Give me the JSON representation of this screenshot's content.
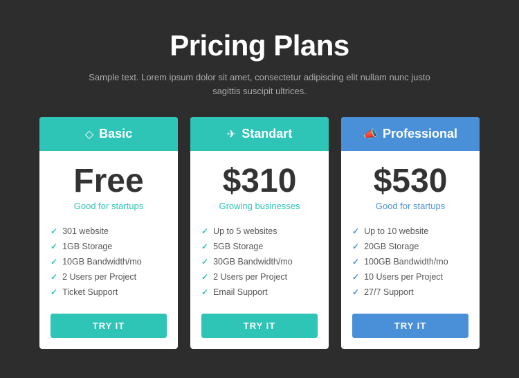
{
  "header": {
    "title": "Pricing Plans",
    "subtitle": "Sample text. Lorem ipsum dolor sit amet, consectetur adipiscing elit nullam nunc justo sagittis suscipit ultrices."
  },
  "plans": [
    {
      "id": "basic",
      "icon": "◇",
      "name": "Basic",
      "price": "Free",
      "tagline": "Good for startups",
      "tagline_class": "teal",
      "header_class": "basic",
      "cta_label": "TRY IT",
      "cta_class": "teal",
      "check_class": "",
      "features": [
        "301 website",
        "1GB Storage",
        "10GB Bandwidth/mo",
        "2 Users per Project",
        "Ticket Support"
      ]
    },
    {
      "id": "standart",
      "icon": "✈",
      "name": "Standart",
      "price": "$310",
      "tagline": "Growing businesses",
      "tagline_class": "teal",
      "header_class": "standart",
      "cta_label": "TRY IT",
      "cta_class": "teal",
      "check_class": "",
      "features": [
        "Up to 5 websites",
        "5GB Storage",
        "30GB Bandwidth/mo",
        "2 Users per Project",
        "Email Support"
      ]
    },
    {
      "id": "professional",
      "icon": "📣",
      "name": "Professional",
      "price": "$530",
      "tagline": "Good for startups",
      "tagline_class": "blue",
      "header_class": "professional",
      "cta_label": "TRY IT",
      "cta_class": "blue-btn",
      "check_class": "blue",
      "features": [
        "Up to 10 website",
        "20GB Storage",
        "100GB Bandwidth/mo",
        "10 Users per Project",
        "27/7 Support"
      ]
    }
  ]
}
